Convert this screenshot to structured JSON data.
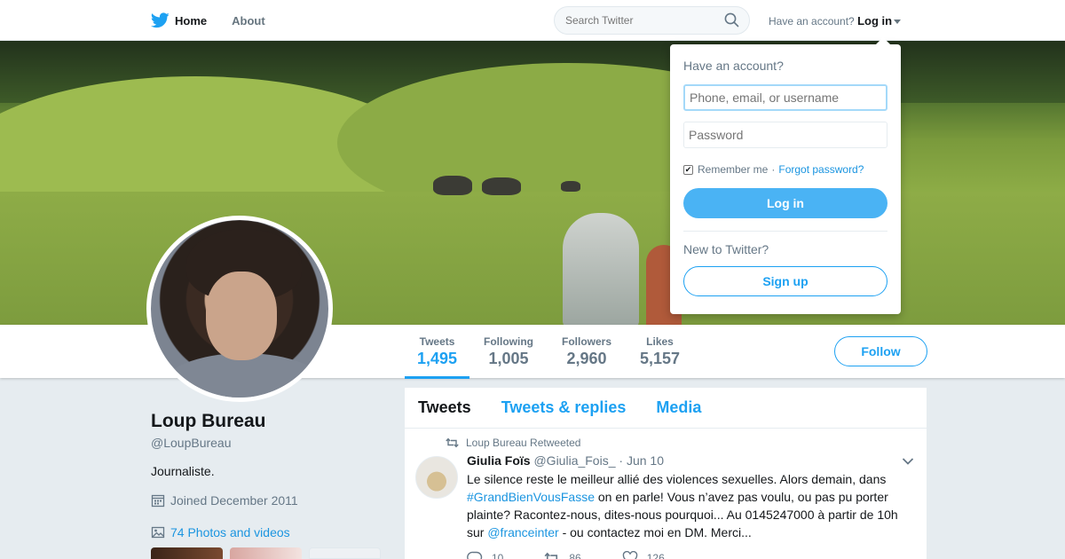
{
  "nav": {
    "home_label": "Home",
    "about_label": "About",
    "search_placeholder": "Search Twitter",
    "account_prompt": "Have an account?",
    "login_label": "Log in"
  },
  "profile": {
    "name": "Loup Bureau",
    "handle": "@LoupBureau",
    "bio": "Journaliste.",
    "joined": "Joined December 2011",
    "photos": "74 Photos and videos",
    "follow_label": "Follow",
    "stats": [
      {
        "label": "Tweets",
        "value": "1,495"
      },
      {
        "label": "Following",
        "value": "1,005"
      },
      {
        "label": "Followers",
        "value": "2,960"
      },
      {
        "label": "Likes",
        "value": "5,157"
      }
    ]
  },
  "timeline": {
    "tabs": [
      "Tweets",
      "Tweets & replies",
      "Media"
    ],
    "tweet": {
      "retweet_context": "Loup Bureau Retweeted",
      "author": "Giulia Foïs",
      "handle": "@Giulia_Fois_",
      "date": "· Jun 10",
      "text_1": "Le silence reste le meilleur allié des violences sexuelles. Alors demain, dans ",
      "hashtag": "#GrandBienVousFasse",
      "text_2": " on en parle! Vous n’avez pas voulu, ou pas pu porter plainte? Racontez-nous, dites-nous pourquoi... Au 0145247000 à partir de 10h sur ",
      "mention": "@franceinter",
      "text_3": " - ou contactez moi en DM. Merci...",
      "replies": "10",
      "retweets": "86",
      "likes": "126"
    }
  },
  "login_dropdown": {
    "title": "Have an account?",
    "username_placeholder": "Phone, email, or username",
    "password_placeholder": "Password",
    "remember": "Remember me",
    "separator": "·",
    "forgot": "Forgot password?",
    "login_button": "Log in",
    "new_prompt": "New to Twitter?",
    "signup_button": "Sign up"
  },
  "colors": {
    "accent": "#1da1f2",
    "link": "#1b95e0",
    "login_button": "#4ab3f4",
    "background": "#e6ecf0"
  }
}
